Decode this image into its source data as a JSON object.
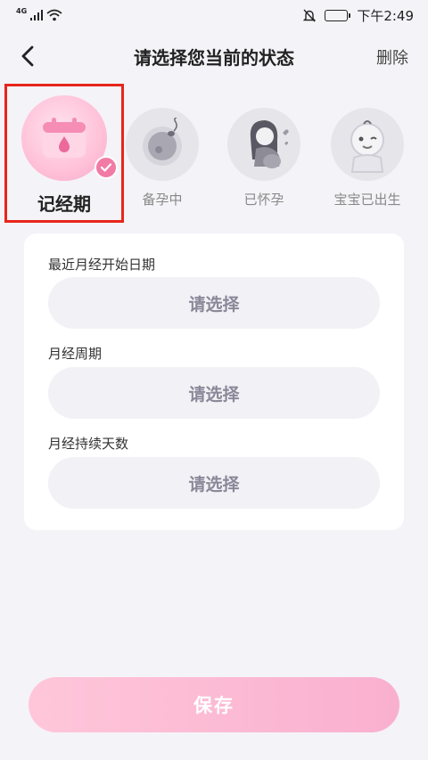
{
  "status_bar": {
    "network": "4G",
    "time": "下午2:49",
    "icons": [
      "signal-icon",
      "wifi-icon",
      "mute-bell-icon",
      "battery-icon"
    ]
  },
  "header": {
    "title": "请选择您当前的状态",
    "delete_label": "删除",
    "back_icon": "chevron-left-icon"
  },
  "status_options": [
    {
      "label": "记经期",
      "icon": "calendar-drop-icon",
      "selected": true
    },
    {
      "label": "备孕中",
      "icon": "sperm-egg-icon",
      "selected": false
    },
    {
      "label": "已怀孕",
      "icon": "pregnant-woman-icon",
      "selected": false
    },
    {
      "label": "宝宝已出生",
      "icon": "baby-icon",
      "selected": false
    }
  ],
  "form": {
    "fields": [
      {
        "label": "最近月经开始日期",
        "value": "请选择"
      },
      {
        "label": "月经周期",
        "value": "请选择"
      },
      {
        "label": "月经持续天数",
        "value": "请选择"
      }
    ]
  },
  "save_label": "保存",
  "colors": {
    "accent": "#f17ba4",
    "highlight": "#e8251b",
    "save_button": "#fbb8d3",
    "background": "#f4f3f8"
  }
}
